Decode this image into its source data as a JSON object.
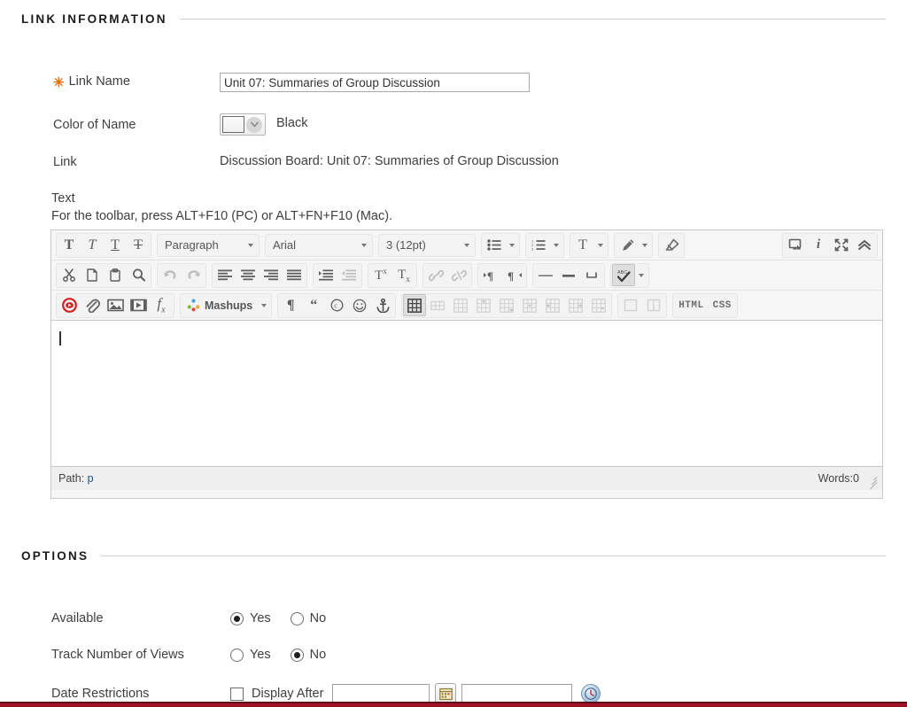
{
  "sections": {
    "link_information": "LINK INFORMATION",
    "options": "OPTIONS"
  },
  "link_information": {
    "link_name": {
      "label": "Link Name",
      "required_marker": "✳",
      "value": "Unit 07: Summaries of Group Discussion"
    },
    "color_of_name": {
      "label": "Color of Name",
      "swatch_hex": "#000000",
      "value": "Black"
    },
    "link": {
      "label": "Link",
      "value": "Discussion Board: Unit 07: Summaries of Group Discussion"
    },
    "text": {
      "label": "Text",
      "hint": "For the toolbar, press ALT+F10 (PC) or ALT+FN+F10 (Mac)."
    }
  },
  "editor": {
    "row1": {
      "format_group": [
        {
          "name": "bold-icon",
          "glyph": "T",
          "style": "bold"
        },
        {
          "name": "italic-icon",
          "glyph": "T",
          "style": "italic"
        },
        {
          "name": "underline-icon",
          "glyph": "T",
          "style": "underline"
        },
        {
          "name": "strikethrough-icon",
          "glyph": "T",
          "style": "strike"
        }
      ],
      "paragraph_select": "Paragraph",
      "font_select": "Arial",
      "size_select": "3 (12pt)",
      "list_group": [
        {
          "name": "bulleted-list-icon"
        },
        {
          "name": "numbered-list-icon"
        }
      ],
      "color_group": [
        {
          "name": "text-color-icon"
        },
        {
          "name": "highlight-color-icon"
        },
        {
          "name": "remove-formatting-icon"
        }
      ],
      "right_group": [
        {
          "name": "preview-icon"
        },
        {
          "name": "help-info-icon"
        },
        {
          "name": "fullscreen-icon"
        },
        {
          "name": "collapse-toolbar-icon"
        }
      ]
    },
    "row2": {
      "clipboard_group": [
        {
          "name": "cut-icon"
        },
        {
          "name": "copy-icon"
        },
        {
          "name": "paste-icon"
        },
        {
          "name": "find-replace-icon"
        }
      ],
      "history_group": [
        {
          "name": "undo-icon",
          "disabled": true
        },
        {
          "name": "redo-icon",
          "disabled": true
        }
      ],
      "align_group": [
        {
          "name": "align-left-icon"
        },
        {
          "name": "align-center-icon"
        },
        {
          "name": "align-right-icon"
        },
        {
          "name": "align-justify-icon"
        }
      ],
      "indent_group": [
        {
          "name": "increase-indent-icon"
        },
        {
          "name": "decrease-indent-icon",
          "disabled": true
        }
      ],
      "script_group": [
        {
          "name": "superscript-icon"
        },
        {
          "name": "subscript-icon"
        }
      ],
      "link_group": [
        {
          "name": "insert-link-icon",
          "disabled": true
        },
        {
          "name": "remove-link-icon",
          "disabled": true
        }
      ],
      "direction_group": [
        {
          "name": "ltr-direction-icon"
        },
        {
          "name": "rtl-direction-icon"
        }
      ],
      "rule_group": [
        {
          "name": "horizontal-rule-icon"
        },
        {
          "name": "em-dash-icon"
        },
        {
          "name": "nonbreaking-space-icon"
        }
      ],
      "spellcheck": {
        "name": "spellcheck-icon",
        "active": true
      }
    },
    "row3": {
      "media_group": [
        {
          "name": "record-from-webcam-icon"
        },
        {
          "name": "attach-file-icon"
        },
        {
          "name": "insert-image-icon"
        },
        {
          "name": "insert-video-icon"
        },
        {
          "name": "math-formula-icon"
        }
      ],
      "mashups_label": "Mashups",
      "symbol_group": [
        {
          "name": "show-blocks-icon"
        },
        {
          "name": "blockquote-icon"
        },
        {
          "name": "copyright-symbol-icon"
        },
        {
          "name": "emoticon-icon"
        },
        {
          "name": "anchor-icon"
        }
      ],
      "table_group": [
        {
          "name": "insert-table-icon",
          "active": true
        },
        {
          "name": "table-row-properties-icon"
        },
        {
          "name": "table-cell-properties-icon"
        },
        {
          "name": "insert-row-before-icon"
        },
        {
          "name": "insert-row-after-icon"
        },
        {
          "name": "delete-row-icon"
        },
        {
          "name": "insert-column-before-icon"
        },
        {
          "name": "insert-column-after-icon"
        },
        {
          "name": "delete-column-icon"
        }
      ],
      "cell_group": [
        {
          "name": "merge-cells-icon"
        },
        {
          "name": "split-cells-icon"
        }
      ],
      "source_group": [
        {
          "name": "html-source-button",
          "label": "HTML"
        },
        {
          "name": "css-source-button",
          "label": "CSS"
        }
      ]
    },
    "body_content": "",
    "status": {
      "path_label": "Path:",
      "path_value": "p",
      "words_label": "Words:0"
    }
  },
  "options": {
    "available": {
      "label": "Available",
      "yes_label": "Yes",
      "no_label": "No",
      "selected": "Yes"
    },
    "track_views": {
      "label": "Track Number of Views",
      "yes_label": "Yes",
      "no_label": "No",
      "selected": "No"
    },
    "date_restrictions": {
      "label": "Date Restrictions",
      "display_after_label": "Display After",
      "display_after_checked": false,
      "date_value": "",
      "date_placeholder": "",
      "time_value": "",
      "time_placeholder": "",
      "calendar_icon": "calendar-picker-icon",
      "clock_icon": "time-picker-icon"
    }
  },
  "colors": {
    "required_star": "#e8700a",
    "label_text": "#3f3f3f",
    "heading_text": "#1b1b1b",
    "rule": "#cfcfcf",
    "toolbar_bg": "#f6f6f6",
    "editor_bg": "#ffffff",
    "status_bg": "#efefef",
    "path_link": "#1c4f8a",
    "record_red": "#d32020",
    "bottom_strip": "#a81427"
  }
}
